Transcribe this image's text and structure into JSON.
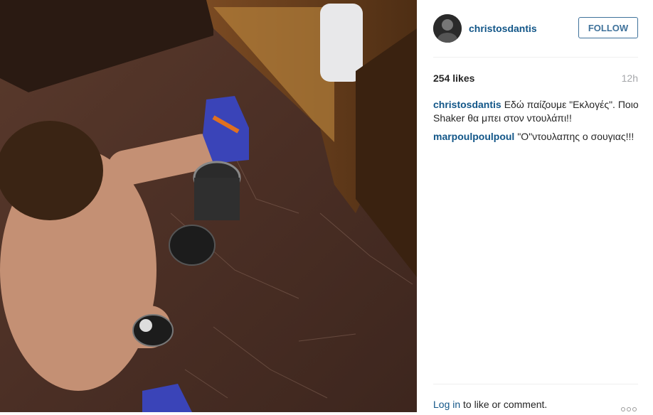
{
  "header": {
    "username": "christosdantis",
    "follow_label": "FOLLOW"
  },
  "stats": {
    "likes": "254 likes",
    "time": "12h"
  },
  "comments": [
    {
      "user": "christosdantis",
      "text": "Εδώ παίζουμε \"Εκλογές\". Ποιο Shaker θα μπει στον ντουλάπι!!"
    },
    {
      "user": "marpoulpoulpoul",
      "text": "\"Ο\"ντουλαπης ο σουγιας!!!"
    }
  ],
  "footer": {
    "login_label": "Log in",
    "rest_label": " to like or comment."
  },
  "colors": {
    "link": "#125688",
    "follow": "#3f729b",
    "muted": "#a5a7aa"
  }
}
